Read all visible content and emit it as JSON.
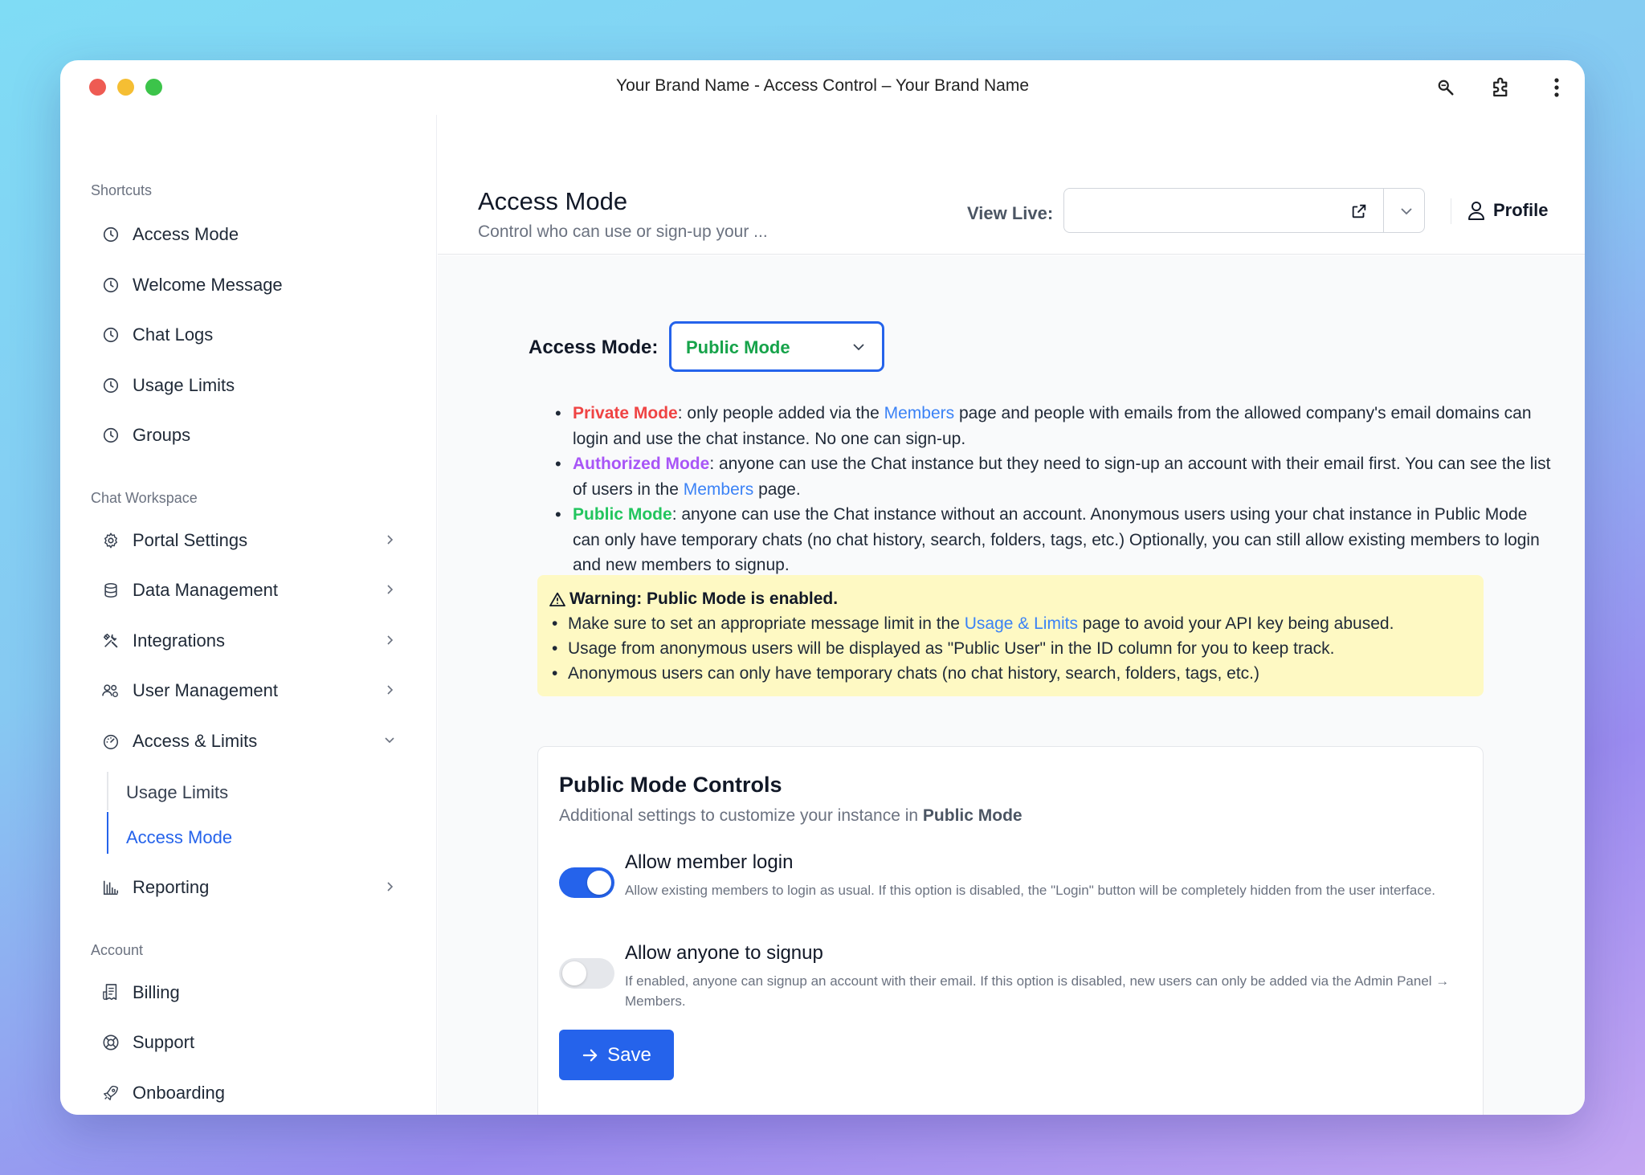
{
  "window": {
    "title": "Your Brand Name - Access Control – Your Brand Name"
  },
  "sidebar": {
    "shortcuts_label": "Shortcuts",
    "shortcuts": [
      {
        "label": "Access Mode",
        "icon": "clock-icon"
      },
      {
        "label": "Welcome Message",
        "icon": "clock-icon"
      },
      {
        "label": "Chat Logs",
        "icon": "clock-icon"
      },
      {
        "label": "Usage Limits",
        "icon": "clock-icon"
      },
      {
        "label": "Groups",
        "icon": "clock-icon"
      }
    ],
    "workspace_label": "Chat Workspace",
    "workspace": [
      {
        "label": "Portal Settings",
        "icon": "gear-icon"
      },
      {
        "label": "Data Management",
        "icon": "database-icon"
      },
      {
        "label": "Integrations",
        "icon": "tools-icon"
      },
      {
        "label": "User Management",
        "icon": "users-icon"
      },
      {
        "label": "Access & Limits",
        "icon": "gauge-icon"
      },
      {
        "label": "Reporting",
        "icon": "bar-chart-icon"
      }
    ],
    "access_sub": [
      {
        "label": "Usage Limits"
      },
      {
        "label": "Access Mode"
      }
    ],
    "account_label": "Account",
    "account": [
      {
        "label": "Billing",
        "icon": "receipt-icon"
      },
      {
        "label": "Support",
        "icon": "lifebuoy-icon"
      },
      {
        "label": "Onboarding",
        "icon": "rocket-icon"
      }
    ]
  },
  "header": {
    "title": "Access Mode",
    "subtitle": "Control who can use or sign-up your ...",
    "view_live_label": "View Live:",
    "view_live_value": "",
    "profile_label": "Profile"
  },
  "access_mode": {
    "label": "Access Mode:",
    "selected": "Public Mode"
  },
  "modes": {
    "private": {
      "name": "Private Mode",
      "text1": ": only people added via the ",
      "link": "Members",
      "text2": " page and people with emails from the allowed company's email domains can login and use the chat instance. No one can sign-up."
    },
    "authorized": {
      "name": "Authorized Mode",
      "text1": ": anyone can use the Chat instance but they need to sign-up an account with their email first. You can see the list of users in the ",
      "link": "Members",
      "text2": " page."
    },
    "public": {
      "name": "Public Mode",
      "text1": ": anyone can use the Chat instance without an account. Anonymous users using your chat instance in Public Mode can only have temporary chats (no chat history, search, folders, tags, etc.) Optionally, you can still allow existing members to login and new members to signup."
    }
  },
  "warning": {
    "title": "Warning: Public Mode is enabled.",
    "item1_a": "Make sure to set an appropriate message limit in the ",
    "item1_link": "Usage & Limits",
    "item1_b": " page to avoid your API key being abused.",
    "item2": "Usage from anonymous users will be displayed as \"Public User\" in the ID column for you to keep track.",
    "item3": "Anonymous users can only have temporary chats (no chat history, search, folders, tags, etc.)"
  },
  "controls": {
    "title": "Public Mode Controls",
    "subtitle_a": "Additional settings to customize your instance in ",
    "subtitle_b": "Public Mode",
    "options": [
      {
        "title": "Allow member login",
        "desc": "Allow existing members to login as usual. If this option is disabled, the \"Login\" button will be completely hidden from the user interface.",
        "enabled": true
      },
      {
        "title": "Allow anyone to signup",
        "desc": "If enabled, anyone can signup an account with their email. If this option is disabled, new users can only be added via the Admin Panel → Members.",
        "enabled": false
      }
    ],
    "save_label": "Save"
  },
  "colors": {
    "accent": "#2563eb",
    "private": "#ef4444",
    "authorized": "#a855f7",
    "public": "#22c55e",
    "warning_bg": "#fef9c3"
  }
}
